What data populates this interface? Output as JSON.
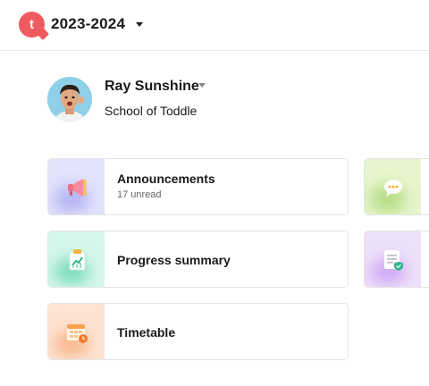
{
  "header": {
    "logo_letter": "t",
    "year": "2023-2024"
  },
  "user": {
    "name": "Ray Sunshine",
    "school": "School of Toddle"
  },
  "cards": [
    {
      "title": "Announcements",
      "subtitle": "17 unread",
      "icon": "megaphone-icon",
      "tint": "#e3e3fb"
    },
    {
      "title": "Progress summary",
      "icon": "progress-chart-icon",
      "tint": "#d5f7ea"
    },
    {
      "title": "Timetable",
      "icon": "calendar-clock-icon",
      "tint": "#fde3d2"
    }
  ],
  "partial_cards": [
    {
      "icon": "chat-bubble-icon",
      "tint": "#e6f5cc"
    },
    {
      "icon": "report-badge-icon",
      "tint": "#eee0fb"
    }
  ],
  "colors": {
    "brand": "#ef5b5e",
    "border": "#e4e4e4"
  }
}
